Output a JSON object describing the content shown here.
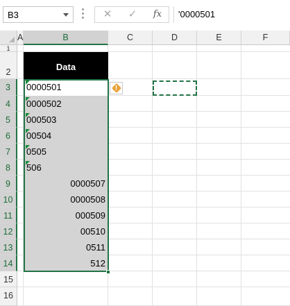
{
  "name_box": {
    "value": "B3"
  },
  "formula_bar": {
    "cancel_glyph": "✕",
    "enter_glyph": "✓",
    "fx_label": "fx",
    "content": "'0000501"
  },
  "columns": [
    "A",
    "B",
    "C",
    "D",
    "E",
    "F"
  ],
  "selected_column": "B",
  "rows": [
    "1",
    "2",
    "3",
    "4",
    "5",
    "6",
    "7",
    "8",
    "9",
    "10",
    "11",
    "12",
    "13",
    "14",
    "15",
    "16"
  ],
  "selected_rows": [
    "3",
    "4",
    "5",
    "6",
    "7",
    "8",
    "9",
    "10",
    "11",
    "12",
    "13",
    "14"
  ],
  "table": {
    "header": "Data",
    "cells": [
      {
        "value": "0000501",
        "align": "left",
        "text_number_flag": true
      },
      {
        "value": "0000502",
        "align": "left",
        "text_number_flag": true
      },
      {
        "value": "000503",
        "align": "left",
        "text_number_flag": true
      },
      {
        "value": "00504",
        "align": "left",
        "text_number_flag": true
      },
      {
        "value": "0505",
        "align": "left",
        "text_number_flag": true
      },
      {
        "value": "506",
        "align": "left",
        "text_number_flag": true
      },
      {
        "value": "0000507",
        "align": "right",
        "text_number_flag": false
      },
      {
        "value": "0000508",
        "align": "right",
        "text_number_flag": false
      },
      {
        "value": "000509",
        "align": "right",
        "text_number_flag": false
      },
      {
        "value": "00510",
        "align": "right",
        "text_number_flag": false
      },
      {
        "value": "0511",
        "align": "right",
        "text_number_flag": false
      },
      {
        "value": "512",
        "align": "right",
        "text_number_flag": false
      }
    ]
  },
  "error_indicator": {
    "glyph": "!"
  },
  "colors": {
    "accent": "#217346",
    "header_fill": "#000000",
    "header_text": "#ffffff",
    "selection_fill": "#d4d4d4",
    "warning": "#e8a33a"
  }
}
